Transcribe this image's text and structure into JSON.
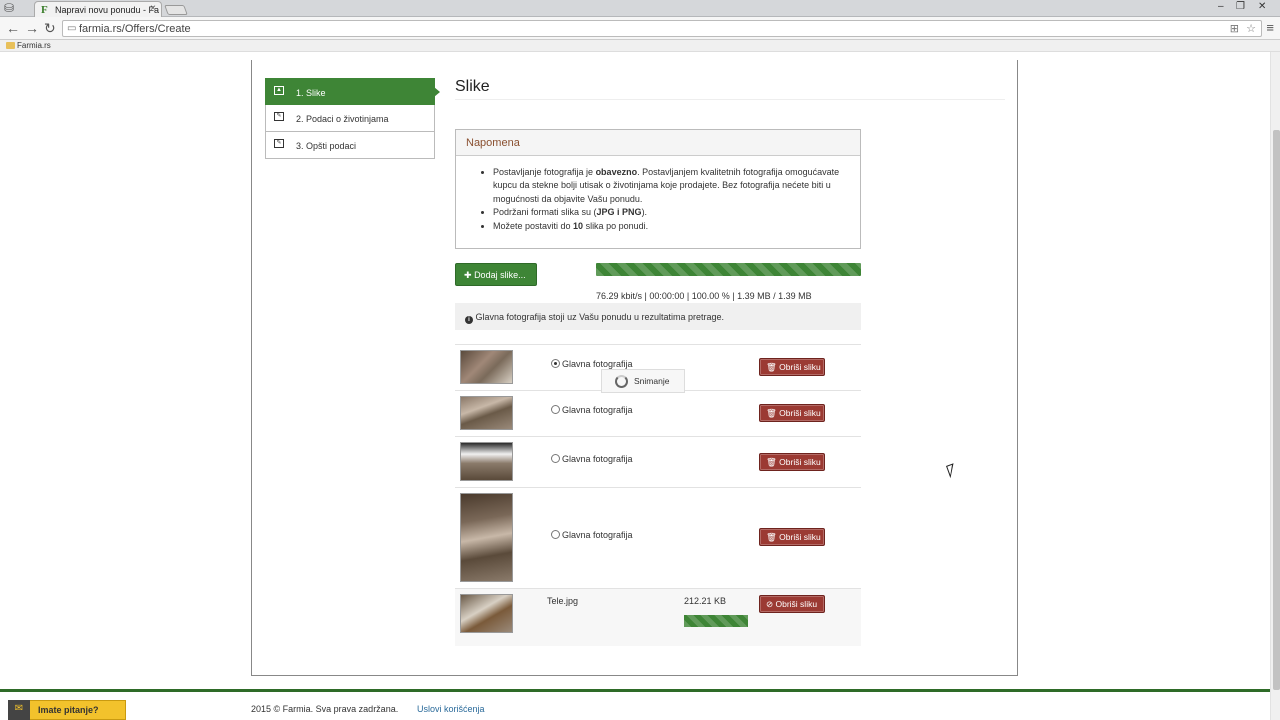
{
  "browser": {
    "tab_title": "Napravi novu ponudu - Fa",
    "favicon_letter": "F",
    "url": "farmia.rs/Offers/Create",
    "bookmark": "Farmia.rs"
  },
  "steps": [
    {
      "label": "1. Slike"
    },
    {
      "label": "2. Podaci o životinjama"
    },
    {
      "label": "3. Opšti podaci"
    }
  ],
  "page": {
    "title": "Slike"
  },
  "note": {
    "title": "Napomena",
    "line1_a": "Postavljanje fotografija je ",
    "line1_b": "obavezno",
    "line1_c": ". Postavljanjem kvalitetnih fotografija omogućavate kupcu da stekne bolji utisak o životinjama koje prodajete. Bez fotografija nećete biti u mogućnosti da objavite Vašu ponudu.",
    "line2_a": "Podržani formati slika su (",
    "line2_b": "JPG i PNG",
    "line2_c": ").",
    "line3_a": "Možete postaviti do ",
    "line3_b": "10",
    "line3_c": " slika po ponudi."
  },
  "upload": {
    "add_button": "Dodaj slike...",
    "stats": "76.29 kbit/s | 00:00:00 | 100.00 % | 1.39 MB / 1.39 MB",
    "progress_percent": 100
  },
  "info": {
    "text": "Glavna fotografija stoji uz Vašu ponudu u rezultatima pretrage."
  },
  "photos": [
    {
      "radio_label": "Glavna fotografija",
      "selected": true,
      "delete_label": "Obriši sliku"
    },
    {
      "radio_label": "Glavna fotografija",
      "selected": false,
      "delete_label": "Obriši sliku"
    },
    {
      "radio_label": "Glavna fotografija",
      "selected": false,
      "delete_label": "Obriši sliku"
    },
    {
      "radio_label": "Glavna fotografija",
      "selected": false,
      "delete_label": "Obriši sliku"
    }
  ],
  "pending_file": {
    "name": "Tele.jpg",
    "size": "212.21 KB",
    "delete_label": "Obriši sliku",
    "progress_percent": 100
  },
  "saving_popup": "Snimanje",
  "footer": {
    "copyright": "2015 © Farmia. Sva prava zadržana.",
    "terms_link": "Uslovi korišćenja",
    "question_button": "Imate pitanje?"
  },
  "colors": {
    "brand_green": "#3e8536",
    "delete_red": "#9b3a33",
    "note_title": "#8a5030"
  }
}
